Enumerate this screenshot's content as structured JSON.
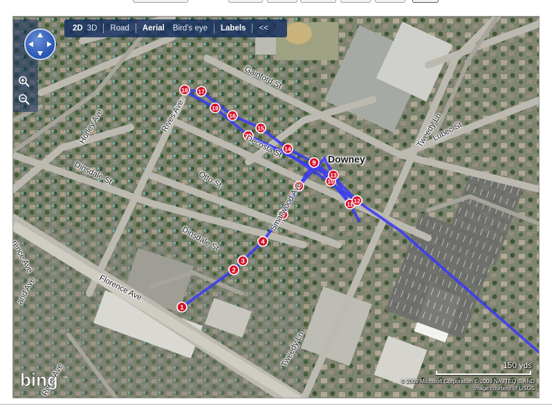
{
  "toolbar": {
    "view_2d": "2D",
    "view_3d": "3D",
    "road": "Road",
    "aerial": "Aerial",
    "birds_eye": "Bird's eye",
    "labels": "Labels",
    "collapse": "<<"
  },
  "streets": {
    "gainford": "Gainford St",
    "rives_top": "Rives Ave",
    "horley": "Horley Ave",
    "dinsdale_left": "Dinsdale St",
    "otto": "Otto St",
    "dinsdale_mid": "Dinsdale St",
    "decosta": "Decosta St",
    "smallwood": "Smallwood Ave",
    "tweedy_top": "Tweedy Ln",
    "lubec": "Lubec St",
    "florence": "Florence Ave",
    "tweedy_bottom": "Tweedy Ln",
    "rives_bottom": "Rives Ave",
    "rence_ave": "rence Ave",
    "and_ave": "and Ave"
  },
  "city_label": "Downey",
  "waypoints": [
    "1",
    "2",
    "3",
    "4",
    "5",
    "6",
    "9",
    "10",
    "11",
    "12",
    "13",
    "14",
    "15",
    "16",
    "17",
    "18",
    "19",
    "20"
  ],
  "scale": {
    "label": "150 yds"
  },
  "copyright": {
    "line1": "© 2009 Microsoft Corporation   © 2009 NAVTEQ   © AND",
    "line2": "Image courtesy of USGS"
  },
  "logo_text": "bing",
  "colors": {
    "route": "#3b3bf0",
    "waypoint_fill": "#d8102a",
    "toolbar": "#142d5f"
  }
}
